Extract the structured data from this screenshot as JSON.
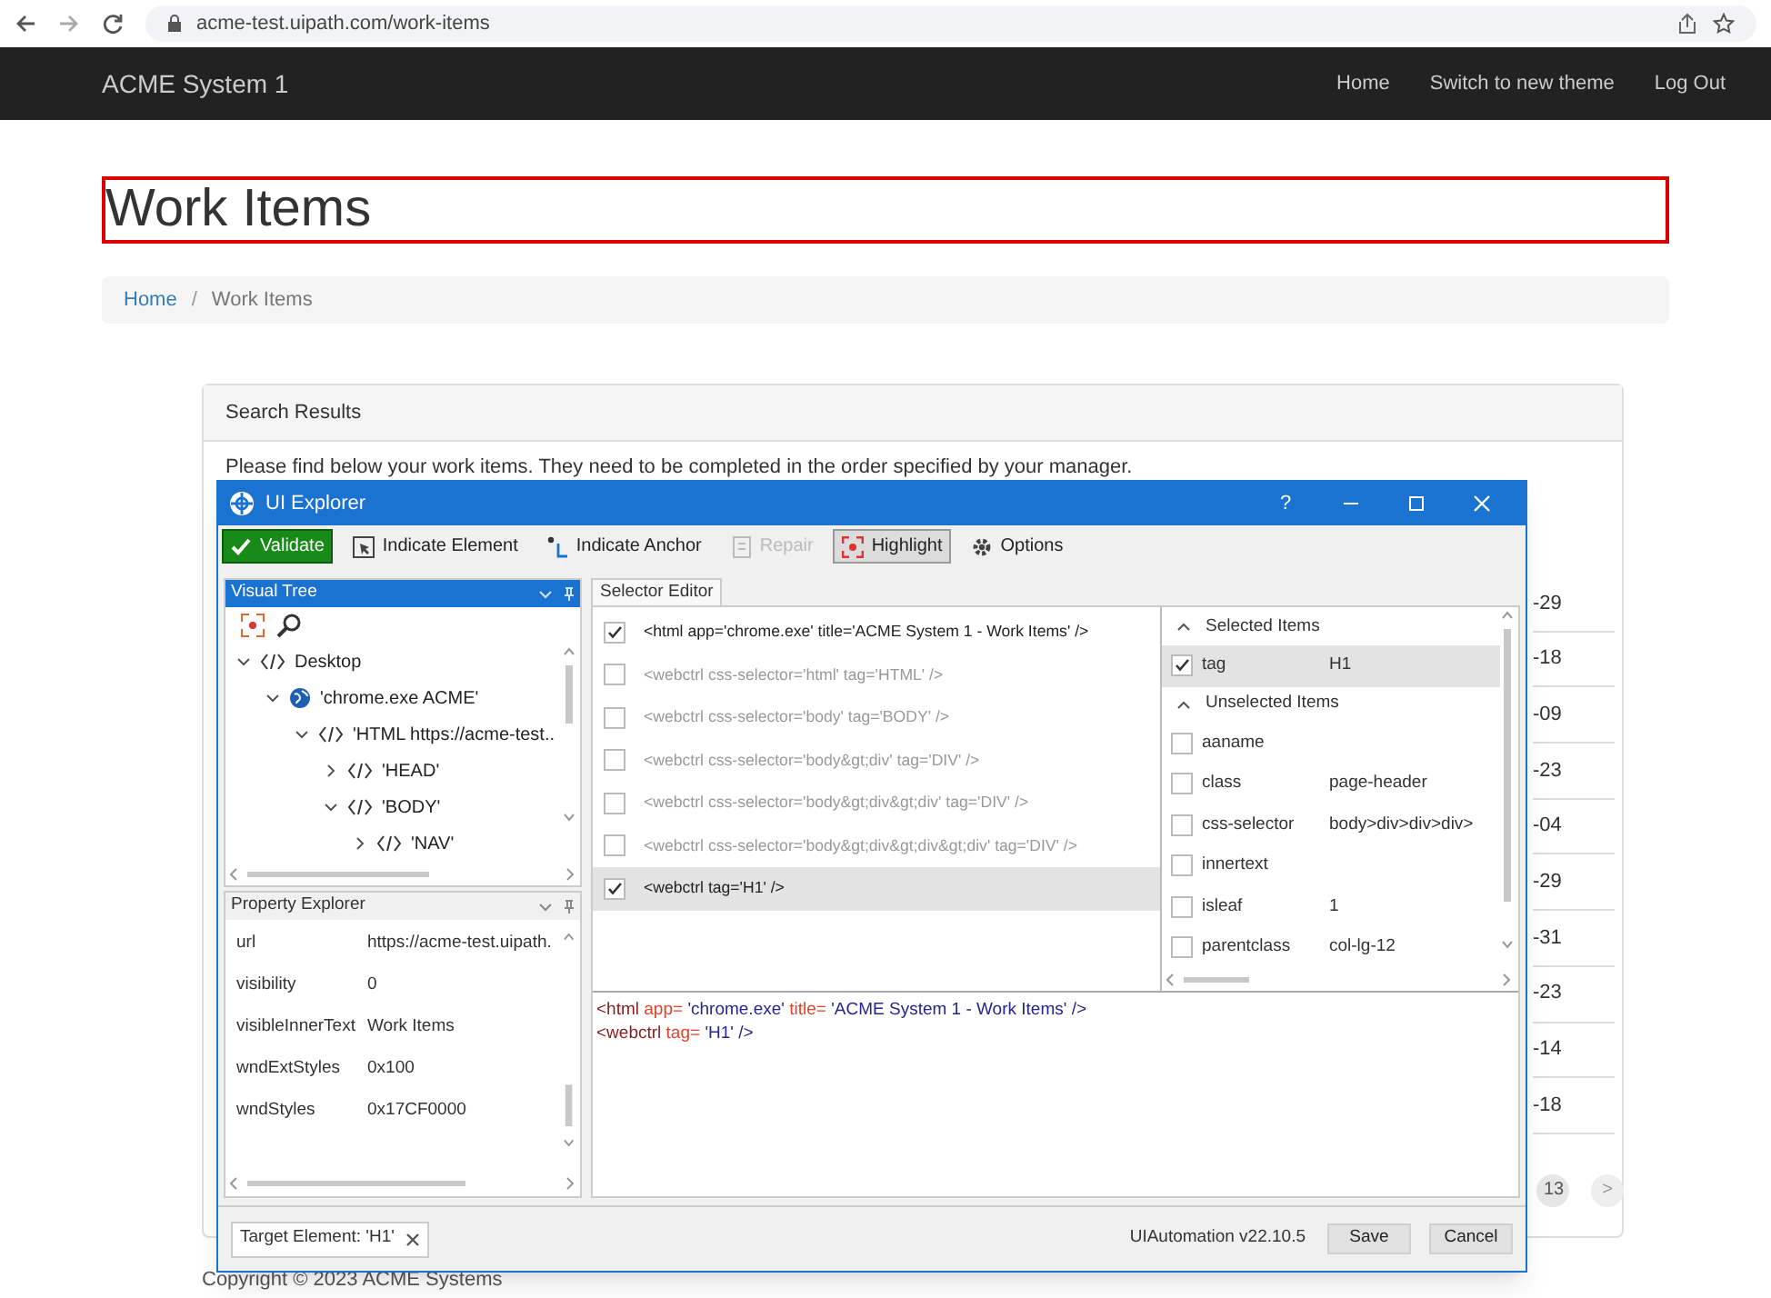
{
  "browser": {
    "url": "acme-test.uipath.com/work-items"
  },
  "navbar": {
    "brand": "ACME System 1",
    "links": [
      "Home",
      "Switch to new theme",
      "Log Out"
    ]
  },
  "page": {
    "heading": "Work Items",
    "heading_highlighted": true,
    "breadcrumb": [
      {
        "label": "Home",
        "kind": "link"
      },
      {
        "label": "/",
        "kind": "separator"
      },
      {
        "label": "Work Items",
        "kind": "current"
      }
    ],
    "results": {
      "title": "Search Results",
      "intro": "Please find below your work items. They need to be completed in the order specified by your manager.",
      "column_fragments": [
        "-29",
        "-18",
        "-09",
        "-23",
        "-04",
        "-29",
        "-31",
        "-23",
        "-14",
        "-18"
      ],
      "pagination": [
        {
          "label": "13",
          "kind": "page"
        },
        {
          "label": ">",
          "kind": "next"
        }
      ]
    },
    "footer": "Copyright © 2023 ACME Systems"
  },
  "ui_explorer": {
    "title": "UI Explorer",
    "help": "?",
    "toolbar": [
      {
        "label": "Validate",
        "kind": "validate",
        "disabled": false,
        "pressed": false
      },
      {
        "label": "Indicate Element",
        "kind": "indicate-element",
        "disabled": false,
        "pressed": false
      },
      {
        "label": "Indicate Anchor",
        "kind": "indicate-anchor",
        "disabled": false,
        "pressed": false
      },
      {
        "label": "Repair",
        "kind": "repair",
        "disabled": true,
        "pressed": false
      },
      {
        "label": "Highlight",
        "kind": "highlight",
        "disabled": false,
        "pressed": true
      },
      {
        "label": "Options",
        "kind": "options",
        "disabled": false,
        "pressed": false
      }
    ],
    "visual_tree": {
      "title": "Visual Tree",
      "active": true,
      "nodes": [
        {
          "label": "Desktop",
          "kind": "element",
          "expanded": true,
          "children": [
            {
              "label": "'chrome.exe ACME'",
              "kind": "app",
              "expanded": true,
              "children": [
                {
                  "label": "'HTML  https://acme-test..",
                  "kind": "element",
                  "expanded": true,
                  "children": [
                    {
                      "label": "'HEAD'",
                      "kind": "element",
                      "expanded": false
                    },
                    {
                      "label": "'BODY'",
                      "kind": "element",
                      "expanded": true,
                      "children": [
                        {
                          "label": "'NAV'",
                          "kind": "element",
                          "expanded": false
                        }
                      ]
                    }
                  ]
                }
              ]
            }
          ]
        }
      ]
    },
    "property_explorer": {
      "title": "Property Explorer",
      "active": false,
      "properties": [
        {
          "name": "url",
          "value": "https://acme-test.uipath."
        },
        {
          "name": "visibility",
          "value": "0"
        },
        {
          "name": "visibleInnerText",
          "value": "Work Items"
        },
        {
          "name": "wndExtStyles",
          "value": "0x100"
        },
        {
          "name": "wndStyles",
          "value": "0x17CF0000"
        }
      ]
    },
    "selector_editor": {
      "tab": "Selector Editor",
      "nodes": [
        {
          "text": "<html app='chrome.exe' title='ACME System 1 - Work Items' />",
          "checked": true,
          "selected": false
        },
        {
          "text": "<webctrl css-selector='html' tag='HTML' />",
          "checked": false,
          "selected": false
        },
        {
          "text": "<webctrl css-selector='body' tag='BODY' />",
          "checked": false,
          "selected": false
        },
        {
          "text": "<webctrl css-selector='body&gt;div' tag='DIV' />",
          "checked": false,
          "selected": false
        },
        {
          "text": "<webctrl css-selector='body&gt;div&gt;div' tag='DIV' />",
          "checked": false,
          "selected": false
        },
        {
          "text": "<webctrl css-selector='body&gt;div&gt;div&gt;div' tag='DIV' />",
          "checked": false,
          "selected": false
        },
        {
          "text": "<webctrl tag='H1' />",
          "checked": true,
          "selected": true
        }
      ]
    },
    "attributes": [
      {
        "title": "Selected Items",
        "expanded": true,
        "items": [
          {
            "name": "tag",
            "value": "H1",
            "checked": true,
            "selected": true
          }
        ]
      },
      {
        "title": "Unselected Items",
        "expanded": true,
        "items": [
          {
            "name": "aaname",
            "value": "",
            "checked": false,
            "selected": false
          },
          {
            "name": "class",
            "value": "page-header",
            "checked": false,
            "selected": false
          },
          {
            "name": "css-selector",
            "value": "body>div>div>div>",
            "checked": false,
            "selected": false
          },
          {
            "name": "innertext",
            "value": "",
            "checked": false,
            "selected": false
          },
          {
            "name": "isleaf",
            "value": "1",
            "checked": false,
            "selected": false
          },
          {
            "name": "parentclass",
            "value": "col-lg-12",
            "checked": false,
            "selected": false
          }
        ]
      }
    ],
    "selector_code": [
      [
        {
          "kind": "tag",
          "text": "<html"
        },
        {
          "kind": "attr",
          "text": "app="
        },
        {
          "kind": "value",
          "text": "'chrome.exe'"
        },
        {
          "kind": "attr",
          "text": "title="
        },
        {
          "kind": "value",
          "text": "'ACME System 1 - Work Items'"
        },
        {
          "kind": "value",
          "text": "/>"
        }
      ],
      [
        {
          "kind": "tag",
          "text": "<webctrl"
        },
        {
          "kind": "attr",
          "text": "tag="
        },
        {
          "kind": "value",
          "text": "'H1'"
        },
        {
          "kind": "value",
          "text": "/>"
        }
      ]
    ],
    "target_element": "Target Element: 'H1'",
    "version": "UIAutomation v22.10.5",
    "buttons": [
      "Save",
      "Cancel"
    ]
  }
}
